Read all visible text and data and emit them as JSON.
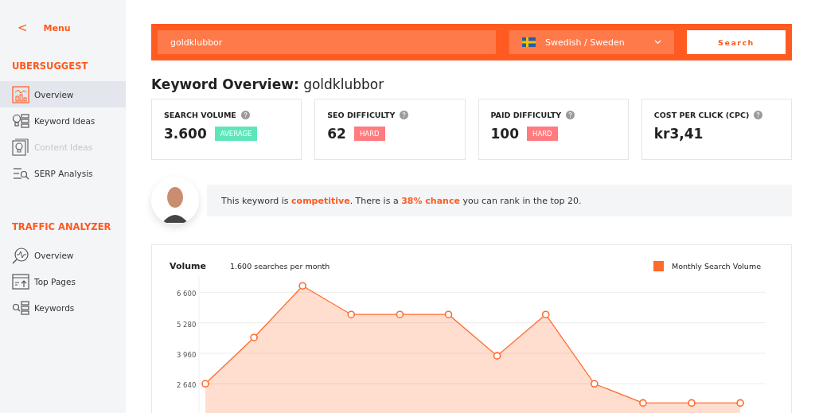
{
  "sidebar": {
    "back": {
      "icon": "<",
      "label": "Menu"
    },
    "sections": [
      {
        "title": "UBERSUGGEST",
        "items": [
          {
            "label": "Overview",
            "kind": "chart",
            "selected": true,
            "disabled": false
          },
          {
            "label": "Keyword Ideas",
            "kind": "bulb-list",
            "selected": false,
            "disabled": false
          },
          {
            "label": "Content Ideas",
            "kind": "bulb-frame",
            "selected": false,
            "disabled": true
          },
          {
            "label": "SERP Analysis",
            "kind": "lines-search",
            "selected": false,
            "disabled": false
          }
        ]
      },
      {
        "title": "TRAFFIC ANALYZER",
        "items": [
          {
            "label": "Overview",
            "kind": "magnifier",
            "selected": false,
            "disabled": false
          },
          {
            "label": "Top Pages",
            "kind": "window",
            "selected": false,
            "disabled": false
          },
          {
            "label": "Keywords",
            "kind": "search-list",
            "selected": false,
            "disabled": false
          }
        ]
      }
    ]
  },
  "search": {
    "value": "goldklubbor",
    "language": "Swedish / Sweden",
    "button": "Search"
  },
  "title": {
    "prefix": "Keyword Overview:",
    "keyword": "goldklubbor"
  },
  "metrics": [
    {
      "label": "SEARCH VOLUME",
      "value": "3.600",
      "badge": "AVERAGE",
      "color": "#5ee6bb"
    },
    {
      "label": "SEO DIFFICULTY",
      "value": "62",
      "badge": "HARD",
      "color": "#ff7b7f"
    },
    {
      "label": "PAID DIFFICULTY",
      "value": "100",
      "badge": "HARD",
      "color": "#ff7b7f"
    },
    {
      "label": "COST PER CLICK (CPC)",
      "value": "kr3,41"
    }
  ],
  "message": "This keyword is **competitive**. There is a **38% chance** you can rank in the top 20.",
  "volume": {
    "title": "Volume",
    "subtitle": "1.600 searches per month",
    "chart_data": {
      "type": "area",
      "grid": true,
      "ylim": [
        1100,
        7300
      ],
      "yticks": [
        {
          "value": 2640,
          "label": "2 640"
        },
        {
          "value": 3960,
          "label": "3 960"
        },
        {
          "value": 5280,
          "label": "5 280"
        },
        {
          "value": 6600,
          "label": "6 600"
        }
      ],
      "series": [
        {
          "name": "Monthly Search Volume",
          "color": "#ff6a2b",
          "values": [
            2640,
            4640,
            6880,
            5640,
            5640,
            5640,
            3850,
            5640,
            2640,
            1810,
            1810,
            1810
          ]
        }
      ]
    }
  }
}
